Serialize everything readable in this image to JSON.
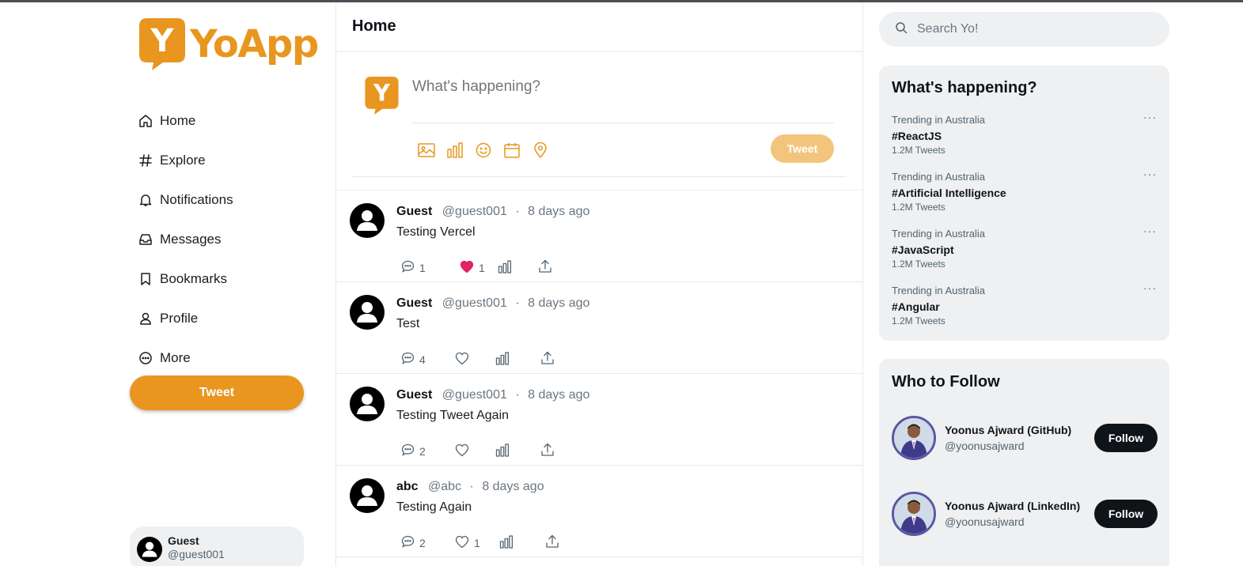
{
  "brand": {
    "name": "YoApp",
    "letter": "Y",
    "color": "#e8961f"
  },
  "nav": [
    {
      "label": "Home",
      "icon": "home-icon"
    },
    {
      "label": "Explore",
      "icon": "hash-icon"
    },
    {
      "label": "Notifications",
      "icon": "bell-icon"
    },
    {
      "label": "Messages",
      "icon": "inbox-icon"
    },
    {
      "label": "Bookmarks",
      "icon": "bookmark-icon"
    },
    {
      "label": "Profile",
      "icon": "user-icon"
    },
    {
      "label": "More",
      "icon": "more-circle-icon"
    }
  ],
  "sidebar": {
    "tweet_label": "Tweet"
  },
  "current_user": {
    "name": "Guest",
    "handle": "@guest001"
  },
  "header": {
    "title": "Home"
  },
  "composer": {
    "placeholder": "What's happening?",
    "tweet_label": "Tweet",
    "tools": [
      "image-icon",
      "poll-icon",
      "emoji-icon",
      "schedule-icon",
      "location-icon"
    ]
  },
  "posts": [
    {
      "name": "Guest",
      "handle": "@guest001",
      "dot": "·",
      "time": "8 days ago",
      "text": "Testing Vercel",
      "replies": "1",
      "likes": "1",
      "liked": true
    },
    {
      "name": "Guest",
      "handle": "@guest001",
      "dot": "·",
      "time": "8 days ago",
      "text": "Test",
      "replies": "4",
      "likes": "",
      "liked": false
    },
    {
      "name": "Guest",
      "handle": "@guest001",
      "dot": "·",
      "time": "8 days ago",
      "text": "Testing Tweet Again",
      "replies": "2",
      "likes": "",
      "liked": false
    },
    {
      "name": "abc",
      "handle": "@abc",
      "dot": "·",
      "time": "8 days ago",
      "text": "Testing Again",
      "replies": "2",
      "likes": "1",
      "liked": false
    }
  ],
  "search": {
    "placeholder": "Search Yo!"
  },
  "trends": {
    "title": "What's happening?",
    "more": "···",
    "items": [
      {
        "context": "Trending in Australia",
        "tag": "#ReactJS",
        "count": "1.2M Tweets"
      },
      {
        "context": "Trending in Australia",
        "tag": "#Artificial Intelligence",
        "count": "1.2M Tweets"
      },
      {
        "context": "Trending in Australia",
        "tag": "#JavaScript",
        "count": "1.2M Tweets"
      },
      {
        "context": "Trending in Australia",
        "tag": "#Angular",
        "count": "1.2M Tweets"
      }
    ]
  },
  "who_to_follow": {
    "title": "Who to Follow",
    "follow_label": "Follow",
    "items": [
      {
        "name": "Yoonus Ajward (GitHub)",
        "handle": "@yoonusajward"
      },
      {
        "name": "Yoonus Ajward (LinkedIn)",
        "handle": "@yoonusajward"
      }
    ]
  },
  "colors": {
    "accent": "#e8961f",
    "accent_light": "#f3c57c",
    "like": "#e0245e",
    "panel": "#eef0f1",
    "dark": "#0f1419"
  }
}
